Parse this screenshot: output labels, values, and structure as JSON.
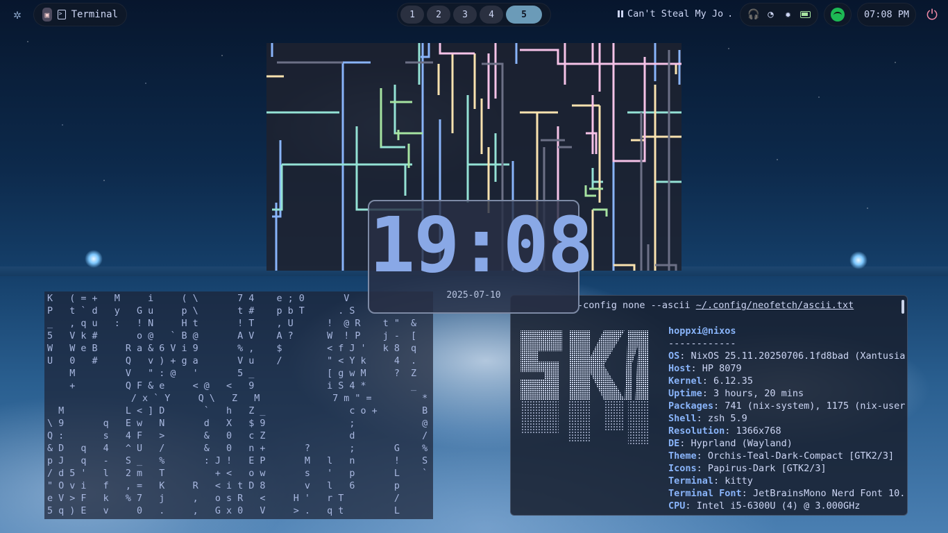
{
  "topbar": {
    "system_icon": "gear-icon",
    "active_window": {
      "app_icon": "terminal-app-icon",
      "title": "Terminal"
    },
    "workspaces": [
      "1",
      "2",
      "3",
      "4",
      "5"
    ],
    "active_workspace": "5",
    "media": {
      "state_icon": "pause-icon",
      "title": "Can't Steal My Jo"
    },
    "status_icons": [
      "headphones-icon",
      "wifi-icon",
      "brightness-icon",
      "battery-icon"
    ],
    "spotify_icon": "spotify-icon",
    "clock": "07:08 PM",
    "power_icon": "power-icon"
  },
  "clock_widget": {
    "time": "19:08",
    "date": "2025-07-10"
  },
  "matrix_lines": [
    "K   ( = +   M     i     ( \\       7 4    e ; 0       V",
    "P   t ` d   y   G u     p \\       t #    p b T      . S",
    "_   , q u   :   ! N     H t       ! T    , U      !  @ R    t \"  &",
    "5   V k #       o @   ` B @       A V    A ?      W  ! P    j -  [",
    "W   W e B     R a & 6 V i 9       % ,    $        < f J '   k 8  q",
    "U   0   #     Q   v ) + g a       V u    /        \" < Y k     4  .",
    "    M         V   \" : @   '       5 _             [ g w M     ?  Z",
    "    +         Q F & e     < @   <   9             i S 4 *        _",
    "               / x ` Y     Q \\   Z   M             7 m \" =         *",
    "  M           L < ] D       `   h   Z _               c o +        B",
    "\\ 9       q   E w   N       d   X   $ 9               ;            @",
    "Q :       s   4 F   >       &   0   c Z               d            /",
    "& D   q   4   ^ U   /       &   0   n +       ?       ;       G    %",
    "p J   q   -   S _   %       : J !   E P       M   l   n       !    S",
    "/ d 5 '   l   2 m   T         + <   o w       s   '   p       L    `",
    "\" O v i   f   , =   K     R   < i t D 8       v   l   6       p",
    "e V > F   k   % 7   j     ,   o s R   <     H '   r T         /",
    "5 q ) E   v     0   .     ,   G x 0   V     > .   q t         L"
  ],
  "neofetch": {
    "command": "-config none --ascii ~/.config/neofetch/ascii.txt",
    "command_prefix": "-config none --ascii ",
    "command_path": "~/.config/neofetch/ascii.txt",
    "user_host": "hoppxi@nixos",
    "separator": "------------",
    "info": [
      {
        "key": "OS",
        "value": "NixOS 25.11.20250706.1fd8bad (Xantusia"
      },
      {
        "key": "Host",
        "value": "HP 8079"
      },
      {
        "key": "Kernel",
        "value": "6.12.35"
      },
      {
        "key": "Uptime",
        "value": "3 hours, 20 mins"
      },
      {
        "key": "Packages",
        "value": "741 (nix-system), 1175 (nix-user"
      },
      {
        "key": "Shell",
        "value": "zsh 5.9"
      },
      {
        "key": "Resolution",
        "value": "1366x768"
      },
      {
        "key": "DE",
        "value": "Hyprland (Wayland)"
      },
      {
        "key": "Theme",
        "value": "Orchis-Teal-Dark-Compact [GTK2/3]"
      },
      {
        "key": "Icons",
        "value": "Papirus-Dark [GTK2/3]"
      },
      {
        "key": "Terminal",
        "value": "kitty"
      },
      {
        "key": "Terminal Font",
        "value": "JetBrainsMono Nerd Font 10."
      },
      {
        "key": "CPU",
        "value": "Intel i5-6300U (4) @ 3.000GHz"
      }
    ]
  },
  "colors": {
    "accent": "#89a8e6",
    "active_ws": "#6b9bb8",
    "power": "#f38ba8",
    "spotify": "#1db954"
  }
}
